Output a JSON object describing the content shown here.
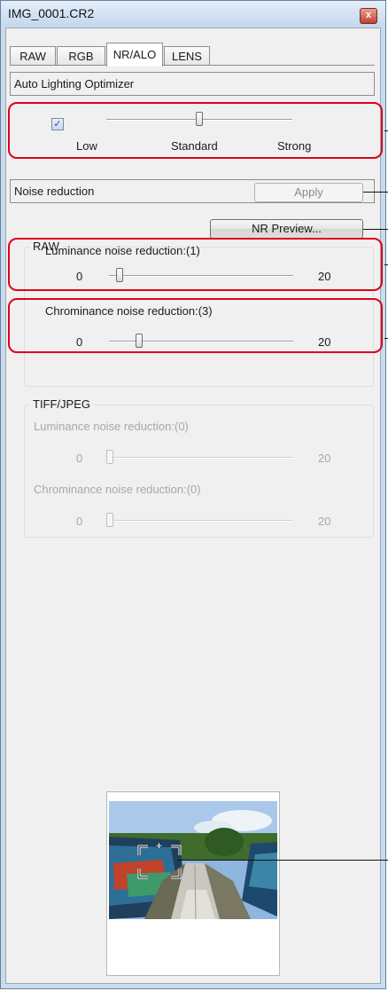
{
  "window": {
    "title": "IMG_0001.CR2",
    "close_glyph": "x"
  },
  "tabs": [
    {
      "label": "RAW"
    },
    {
      "label": "RGB"
    },
    {
      "label": "NR/ALO",
      "active": true
    },
    {
      "label": "LENS"
    }
  ],
  "alo": {
    "section_label": "Auto Lighting Optimizer",
    "checked": true,
    "check_glyph": "✓",
    "labels": [
      "Low",
      "Standard",
      "Strong"
    ],
    "level": "Standard"
  },
  "noise": {
    "section_label": "Noise reduction",
    "apply_label": "Apply",
    "preview_label": "NR Preview..."
  },
  "raw": {
    "group_title": "RAW",
    "luminance_label": "Luminance noise reduction:(1)",
    "luminance_value": 1,
    "chrominance_label": "Chrominance noise reduction:(3)",
    "chrominance_value": 3,
    "min": "0",
    "max": "20"
  },
  "tiff": {
    "group_title": "TIFF/JPEG",
    "luminance_label": "Luminance noise reduction:(0)",
    "luminance_value": 0,
    "chrominance_label": "Chrominance noise reduction:(0)",
    "chrominance_value": 0,
    "min": "0",
    "max": "20"
  },
  "navigator": {
    "zoom_glyph": "+"
  },
  "colors": {
    "highlight": "#e0001b",
    "title_bar": "#c9dbee"
  }
}
